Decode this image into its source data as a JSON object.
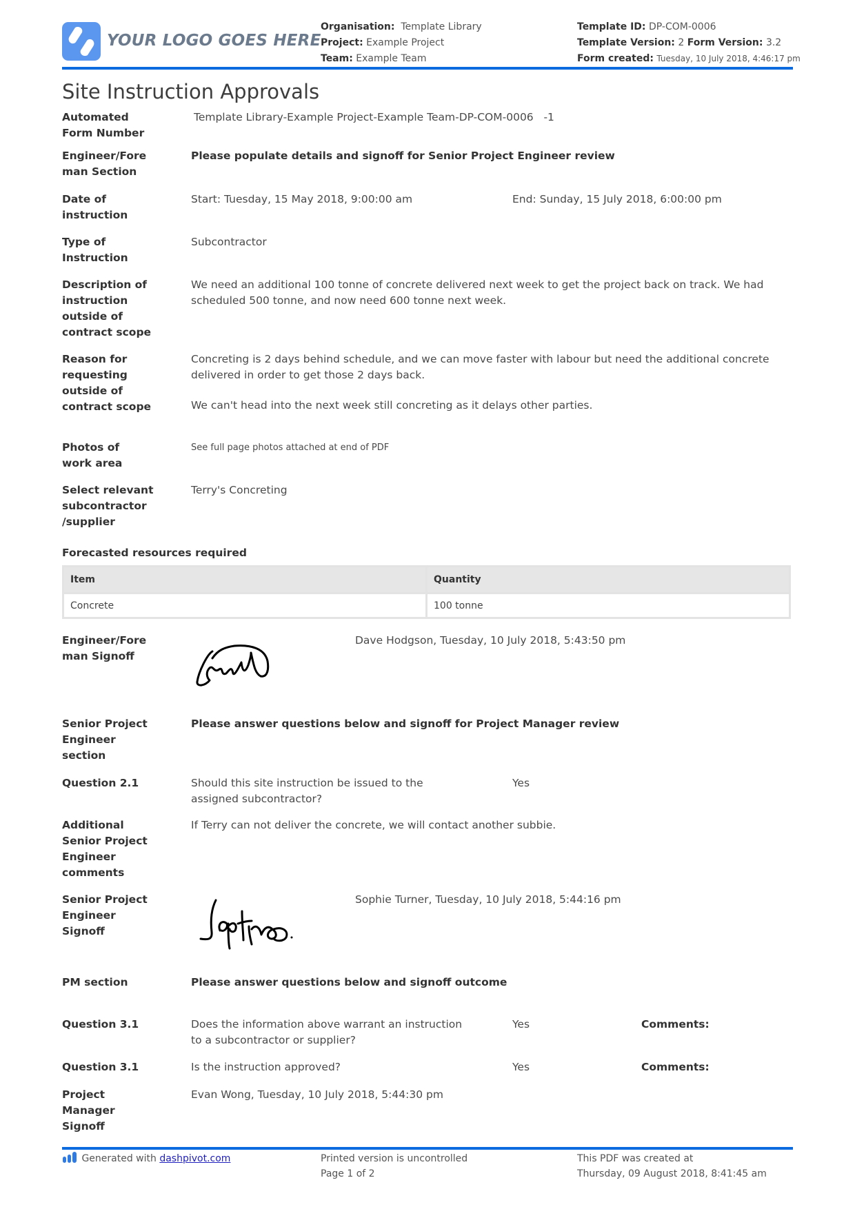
{
  "header": {
    "logo_text": "YOUR LOGO GOES HERE",
    "organisation_label": "Organisation:",
    "organisation_value": "Template Library",
    "project_label": "Project:",
    "project_value": "Example Project",
    "team_label": "Team:",
    "team_value": "Example Team",
    "template_id_label": "Template ID:",
    "template_id_value": "DP-COM-0006",
    "template_version_label": "Template Version:",
    "template_version_value": "2",
    "form_version_label": "Form Version:",
    "form_version_value": "3.2",
    "form_created_label": "Form created:",
    "form_created_value": "Tuesday, 10 July 2018, 4:46:17 pm",
    "accent_color": "#0d6be0"
  },
  "title": "Site Instruction Approvals",
  "fields": {
    "form_number": {
      "label_1": "Automated",
      "label_2": "Form Number",
      "value": "Template Library-Example Project-Example Team-DP-COM-0006",
      "suffix": "-1"
    },
    "engineer_section": {
      "label_1": "Engineer/Fore",
      "label_2": "man Section",
      "value": "Please populate details and signoff for Senior Project Engineer review"
    },
    "date": {
      "label_1": "Date of",
      "label_2": "instruction",
      "start": "Start: Tuesday, 15 May 2018, 9:00:00 am",
      "end": "End: Sunday, 15 July 2018, 6:00:00 pm"
    },
    "type": {
      "label_1": "Type of",
      "label_2": "Instruction",
      "value": "Subcontractor"
    },
    "description": {
      "label_1": "Description of",
      "label_2": "instruction",
      "label_3": "outside of",
      "label_4": "contract scope",
      "line_1": "We need an additional 100 tonne of concrete delivered next week to get the project back on track. We had",
      "line_2": "scheduled 500 tonne, and now need 600 tonne next week."
    },
    "reason": {
      "label_1": "Reason for",
      "label_2": "requesting",
      "label_3": "outside of",
      "label_4": "contract scope",
      "line_1": "Concreting is 2 days behind schedule, and we can move faster with labour but need the additional concrete",
      "line_2": "delivered in order to get those 2 days back.",
      "line_3": "We can't head into the next week still concreting as it delays other parties."
    },
    "photos": {
      "label_1": "Photos of",
      "label_2": "work area",
      "value": "See full page photos attached at end of PDF"
    },
    "subcontractor": {
      "label_1": "Select relevant",
      "label_2": "subcontractor",
      "label_3": "/supplier",
      "value": "Terry's Concreting"
    }
  },
  "resources": {
    "heading": "Forecasted resources required",
    "columns": [
      "Item",
      "Quantity"
    ],
    "rows": [
      [
        "Concrete",
        "100 tonne"
      ]
    ]
  },
  "engineer_signoff": {
    "label_1": "Engineer/Fore",
    "label_2": "man Signoff",
    "signer": "Dave Hodgson, Tuesday, 10 July 2018, 5:43:50 pm"
  },
  "senior_section": {
    "label_1": "Senior Project",
    "label_2": "Engineer",
    "label_3": "section",
    "value": "Please answer questions below and signoff for Project Manager review",
    "q21": {
      "label": "Question 2.1",
      "line_1": "Should this site instruction be issued to the",
      "line_2": "assigned subcontractor?",
      "answer": "Yes"
    },
    "additional": {
      "label_1": "Additional",
      "label_2": "Senior Project",
      "label_3": "Engineer",
      "label_4": "comments",
      "value": "If Terry can not deliver the concrete, we will contact another subbie."
    },
    "signoff": {
      "label_1": "Senior Project",
      "label_2": "Engineer",
      "label_3": "Signoff",
      "signer": "Sophie Turner, Tuesday, 10 July 2018, 5:44:16 pm"
    }
  },
  "pm_section": {
    "label": "PM section",
    "value": "Please answer questions below and signoff outcome",
    "q31a": {
      "label": "Question 3.1",
      "line_1": "Does the information above warrant an instruction",
      "line_2": "to a subcontractor or supplier?",
      "answer": "Yes",
      "comments_label": "Comments:"
    },
    "q31b": {
      "label": "Question 3.1",
      "line_1": "Is the instruction approved?",
      "answer": "Yes",
      "comments_label": "Comments:"
    },
    "signoff": {
      "label_1": "Project",
      "label_2": "Manager",
      "label_3": "Signoff",
      "signer": "Evan Wong, Tuesday, 10 July 2018, 5:44:30 pm"
    }
  },
  "footer": {
    "generated_text": "Generated with",
    "generated_link": "dashpivot.com",
    "uncontrolled": "Printed version is uncontrolled",
    "page": "Page 1 of 2",
    "created_label": "This PDF was created at",
    "created_value": "Thursday, 09 August 2018, 8:41:45 am"
  }
}
